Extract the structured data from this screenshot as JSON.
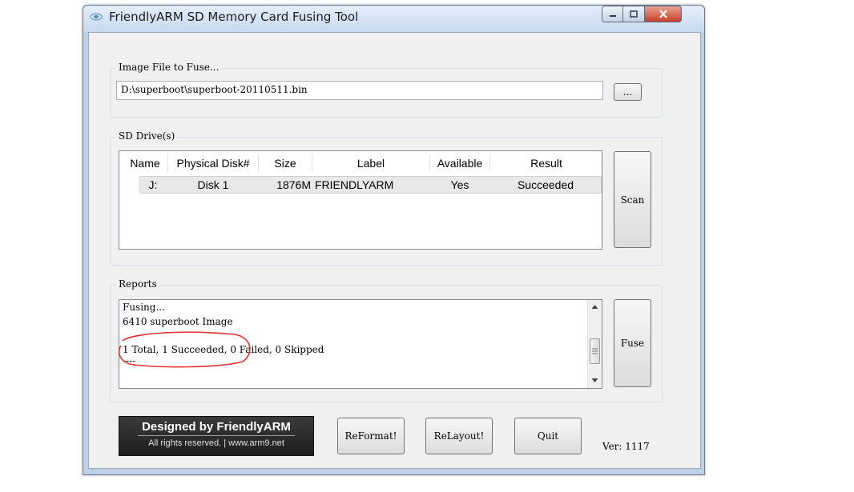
{
  "window": {
    "title": "FriendlyARM SD Memory Card Fusing Tool"
  },
  "image_group": {
    "label": "Image File to Fuse...",
    "path_value": "D:\\superboot\\superboot-20110511.bin",
    "browse_label": "..."
  },
  "drives_group": {
    "label": "SD Drive(s)",
    "columns": [
      "Name",
      "Physical Disk#",
      "Size",
      "Label",
      "Available",
      "Result"
    ],
    "rows": [
      {
        "name": "J:",
        "disk": "Disk 1",
        "size": "1876M",
        "label": "FRIENDLYARM",
        "available": "Yes",
        "result": "Succeeded"
      }
    ],
    "scan_label": "Scan"
  },
  "reports_group": {
    "label": "Reports",
    "lines": [
      "Fusing...",
      "6410 superboot Image",
      "",
      "1 Total, 1 Succeeded, 0 Failed, 0 Skipped",
      "----"
    ],
    "fuse_label": "Fuse"
  },
  "footer": {
    "logo_title": "Designed by FriendlyARM",
    "logo_sub": "All rights reserved. | www.arm9.net",
    "reformat_label": "ReFormat!",
    "relayout_label": "ReLayout!",
    "quit_label": "Quit",
    "version": "Ver: 1117"
  },
  "colors": {
    "title_bar": "#c7d9ee",
    "close_button": "#c7402a",
    "annotation_circle": "#e53030"
  }
}
